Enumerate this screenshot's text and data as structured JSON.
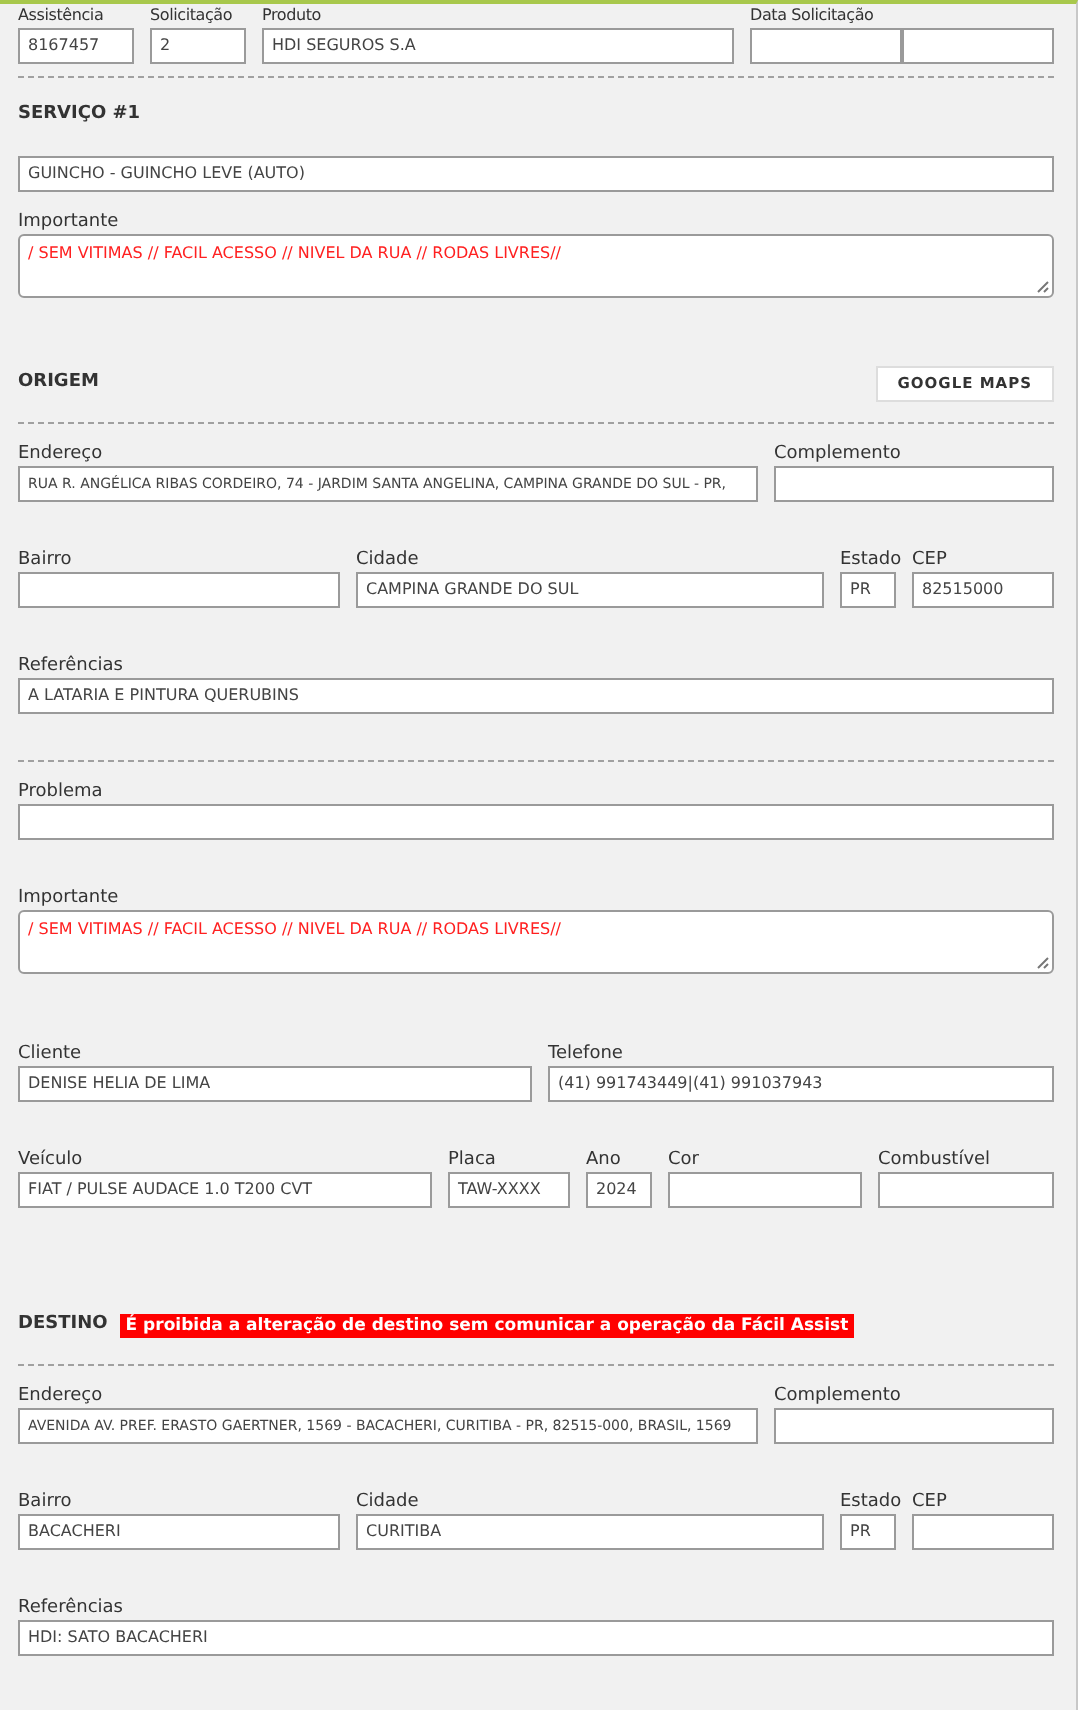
{
  "blocks": [
    {
      "kind": "row",
      "fields": [
        {
          "label": "Assistência",
          "value": "8167457"
        },
        {
          "label": "Solicitação",
          "value": "2"
        },
        {
          "label": "Produto",
          "value": "HDI SEGUROS S.A"
        },
        {
          "label": "Data Solicitação",
          "kind": "datetime"
        }
      ]
    },
    {
      "kind": "divider"
    },
    {
      "kind": "heading",
      "title": "SERVIÇO #1"
    },
    {
      "kind": "row",
      "fields": [
        {
          "value": "GUINCHO - GUINCHO LEVE (AUTO)"
        }
      ]
    },
    {
      "kind": "textarea",
      "label": "Importante",
      "value": "/ SEM VITIMAS // FACIL ACESSO // NIVEL DA RUA // RODAS LIVRES//"
    },
    {
      "kind": "heading",
      "title": "ORIGEM",
      "button": "GOOGLE MAPS"
    },
    {
      "kind": "divider"
    },
    {
      "kind": "row",
      "fields": [
        {
          "label": "Endereço",
          "value": "RUA R. ANGÉLICA RIBAS CORDEIRO, 74 - JARDIM SANTA ANGELINA, CAMPINA GRANDE DO SUL - PR,"
        },
        {
          "label": "Complemento"
        }
      ]
    },
    {
      "kind": "row",
      "fields": [
        {
          "label": "Bairro"
        },
        {
          "label": "Cidade",
          "value": "CAMPINA GRANDE DO SUL"
        },
        {
          "label": "Estado",
          "value": "PR"
        },
        {
          "label": "CEP",
          "value": "82515000"
        }
      ]
    },
    {
      "kind": "row",
      "fields": [
        {
          "label": "Referências",
          "value": "A LATARIA E PINTURA QUERUBINS"
        }
      ]
    },
    {
      "kind": "divider"
    },
    {
      "kind": "row",
      "fields": [
        {
          "label": "Problema"
        }
      ]
    },
    {
      "kind": "textarea",
      "label": "Importante",
      "value": "/ SEM VITIMAS // FACIL ACESSO // NIVEL DA RUA // RODAS LIVRES//"
    },
    {
      "kind": "row",
      "fields": [
        {
          "label": "Cliente",
          "value": "DENISE HELIA DE LIMA"
        },
        {
          "label": "Telefone",
          "value": "(41) 991743449|(41) 991037943"
        }
      ]
    },
    {
      "kind": "row",
      "fields": [
        {
          "label": "Veículo",
          "value": "FIAT / PULSE AUDACE 1.0 T200 CVT"
        },
        {
          "label": "Placa",
          "value": "TAW-XXXX"
        },
        {
          "label": "Ano",
          "value": "2024"
        },
        {
          "label": "Cor"
        },
        {
          "label": "Combustível"
        }
      ]
    },
    {
      "kind": "heading",
      "title": "DESTINO",
      "alert": "É proibida a alteração de destino sem comunicar a operação da Fácil Assist"
    },
    {
      "kind": "divider"
    },
    {
      "kind": "row",
      "fields": [
        {
          "label": "Endereço",
          "value": "AVENIDA AV. PREF. ERASTO GAERTNER, 1569 - BACACHERI, CURITIBA - PR, 82515-000, BRASIL, 1569"
        },
        {
          "label": "Complemento"
        }
      ]
    },
    {
      "kind": "row",
      "fields": [
        {
          "label": "Bairro",
          "value": "BACACHERI"
        },
        {
          "label": "Cidade",
          "value": "CURITIBA"
        },
        {
          "label": "Estado",
          "value": "PR"
        },
        {
          "label": "CEP"
        }
      ]
    },
    {
      "kind": "row",
      "fields": [
        {
          "label": "Referências",
          "value": "HDI: SATO BACACHERI"
        }
      ]
    }
  ]
}
